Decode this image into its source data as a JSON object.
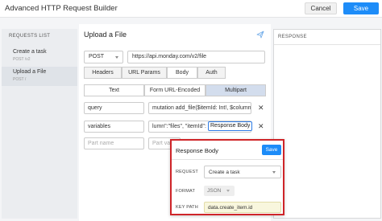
{
  "header": {
    "title": "Advanced HTTP Request Builder",
    "cancel_label": "Cancel",
    "save_label": "Save"
  },
  "sidebar": {
    "title": "REQUESTS LIST",
    "items": [
      {
        "name": "Create a task",
        "method": "POST /v2"
      },
      {
        "name": "Upload a File",
        "method": "POST /"
      }
    ]
  },
  "request": {
    "title": "Upload a File",
    "method": "POST",
    "url": "https://api.monday.com/v2/file",
    "tabs": [
      "Headers",
      "URL Params",
      "Body",
      "Auth"
    ],
    "active_tab": "Body",
    "body_types": [
      "Text",
      "Form URL-Encoded",
      "Multipart"
    ],
    "active_body_type": "Multipart",
    "parts": [
      {
        "name": "query",
        "value": "mutation add_file($itemId: Int!, $column"
      },
      {
        "name": "variables",
        "value": "lumn\":\"files\", \"itemId\":",
        "chip": "Response Body"
      }
    ],
    "new_part_name_placeholder": "Part name",
    "new_part_value_placeholder": "Part val"
  },
  "response": {
    "title": "RESPONSE"
  },
  "popover": {
    "title": "Response Body",
    "save_label": "Save",
    "request_label": "REQUEST",
    "request_value": "Create a task",
    "format_label": "FORMAT",
    "format_value": "JSON",
    "keypath_label": "KEY PATH",
    "keypath_value": "data.create_item.id"
  },
  "colors": {
    "accent": "#1d8cf8",
    "highlight_border": "#cf2529",
    "active_subtab": "#d3dded"
  }
}
